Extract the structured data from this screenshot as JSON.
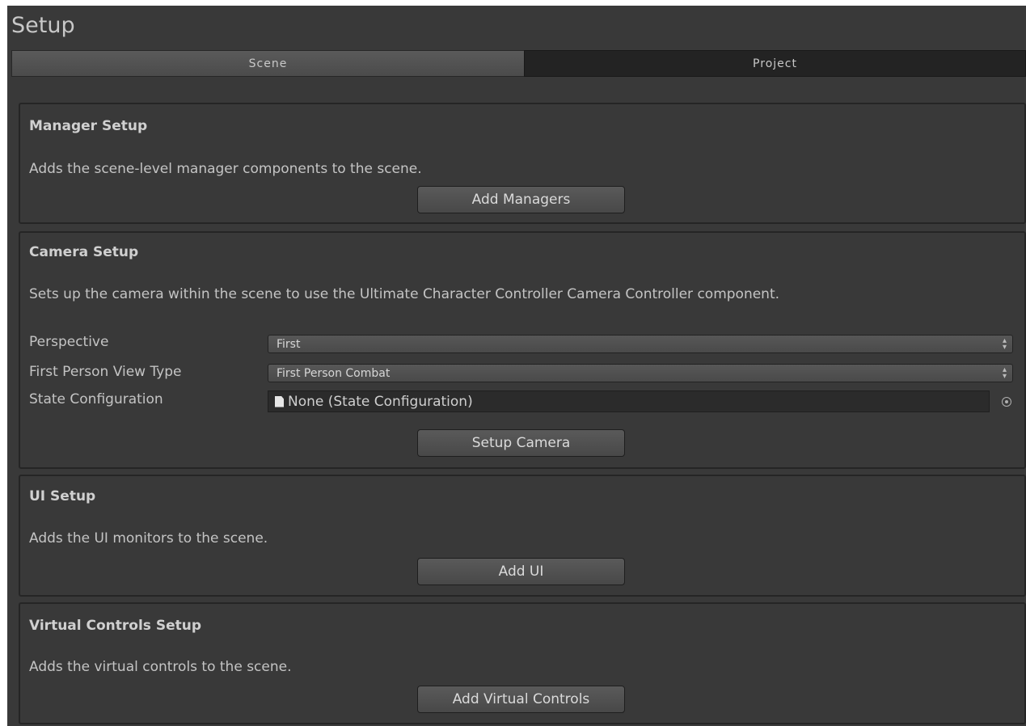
{
  "window": {
    "title": "Setup"
  },
  "tabs": [
    {
      "label": "Scene",
      "active": true
    },
    {
      "label": "Project",
      "active": false
    }
  ],
  "sections": {
    "manager": {
      "title": "Manager Setup",
      "description": "Adds the scene-level manager components to the scene.",
      "button": "Add Managers"
    },
    "camera": {
      "title": "Camera Setup",
      "description": "Sets up the camera within the scene to use the Ultimate Character Controller Camera Controller component.",
      "fields": {
        "perspective": {
          "label": "Perspective",
          "value": "First"
        },
        "view_type": {
          "label": "First Person View Type",
          "value": "First Person Combat"
        },
        "state_config": {
          "label": "State Configuration",
          "value": "None (State Configuration)"
        }
      },
      "button": "Setup Camera"
    },
    "ui": {
      "title": "UI Setup",
      "description": "Adds the UI monitors to the scene.",
      "button": "Add UI"
    },
    "virtual": {
      "title": "Virtual Controls Setup",
      "description": "Adds the virtual controls to the scene.",
      "button": "Add Virtual Controls"
    }
  },
  "icons": {
    "dropdown": "dropdown-arrows-icon",
    "document": "document-icon",
    "picker": "object-picker-icon"
  },
  "colors": {
    "background": "#393939",
    "section_border": "#252525",
    "text": "#c4c4c4",
    "inactive_tab": "#232323"
  }
}
